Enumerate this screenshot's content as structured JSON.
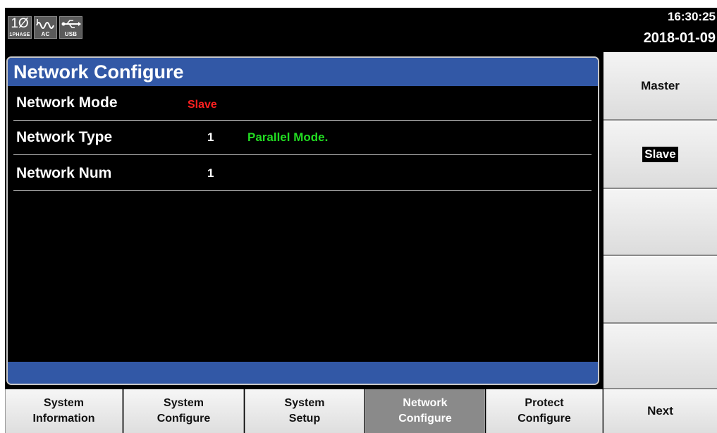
{
  "status": {
    "phase_label": "1PHASE",
    "phase_symbol": "1Ø",
    "ac_label": "AC",
    "usb_label": "USB",
    "time": "16:30:25",
    "date": "2018-01-09"
  },
  "panel": {
    "title": "Network Configure",
    "rows": [
      {
        "label": "Network Mode",
        "value": "",
        "extra": "Slave"
      },
      {
        "label": "Network Type",
        "value": "1",
        "extra": "Parallel Mode."
      },
      {
        "label": "Network Num",
        "value": "1",
        "extra": ""
      }
    ]
  },
  "softkeys": {
    "master": "Master",
    "slave": "Slave",
    "blank3": "",
    "blank4": "",
    "blank5": ""
  },
  "tabs": [
    {
      "label": "System\nInformation"
    },
    {
      "label": "System\nConfigure"
    },
    {
      "label": "System\nSetup"
    },
    {
      "label": "Network\nConfigure"
    },
    {
      "label": "Protect\nConfigure"
    }
  ],
  "next_label": "Next",
  "colors": {
    "title_bar": "#3258a6",
    "slave_value": "#ff2020",
    "parallel_value": "#22dd22",
    "active_tab": "#8a8a8a"
  }
}
